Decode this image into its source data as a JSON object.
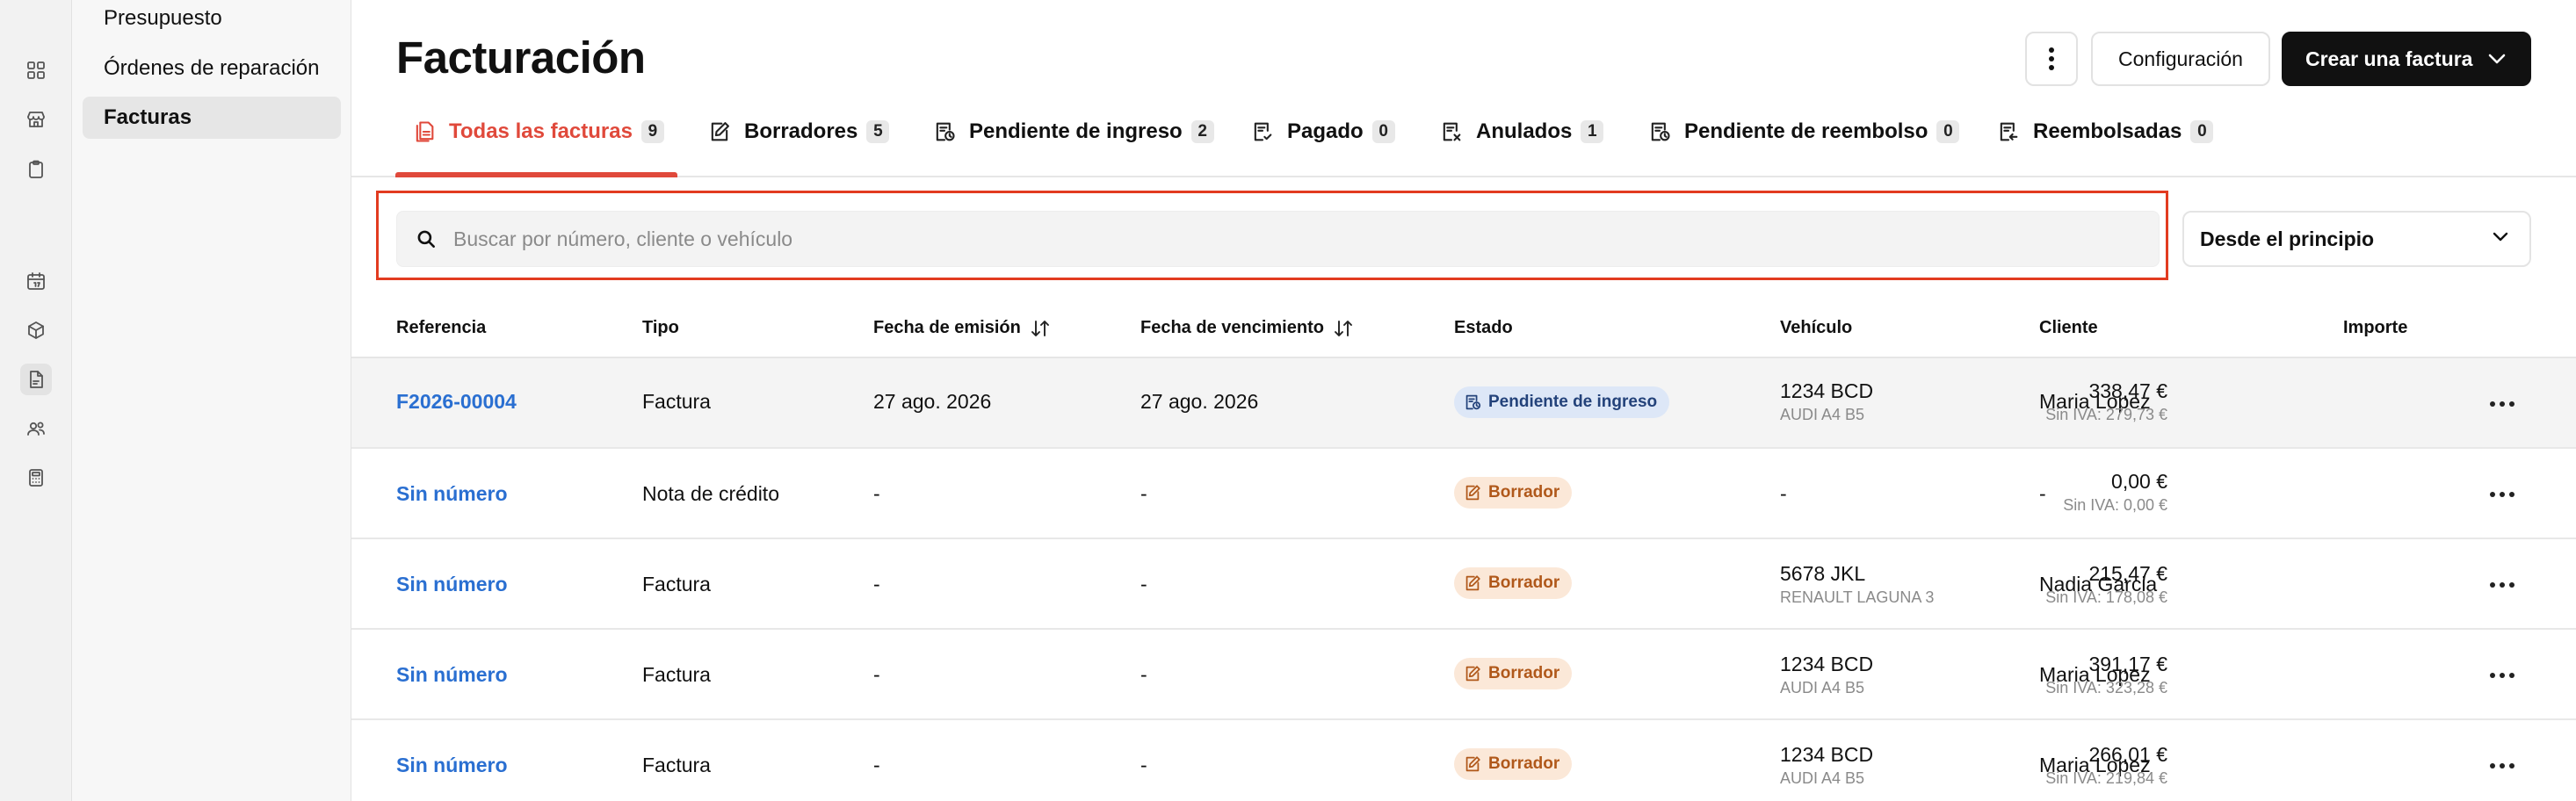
{
  "sidebar": {
    "items": [
      {
        "label": "Presupuesto"
      },
      {
        "label": "Órdenes de reparación"
      },
      {
        "label": "Facturas"
      }
    ]
  },
  "page": {
    "title": "Facturación",
    "config_label": "Configuración",
    "create_label": "Crear una factura"
  },
  "tabs": [
    {
      "label": "Todas las facturas",
      "count": "9"
    },
    {
      "label": "Borradores",
      "count": "5"
    },
    {
      "label": "Pendiente de ingreso",
      "count": "2"
    },
    {
      "label": "Pagado",
      "count": "0"
    },
    {
      "label": "Anulados",
      "count": "1"
    },
    {
      "label": "Pendiente de reembolso",
      "count": "0"
    },
    {
      "label": "Reembolsadas",
      "count": "0"
    }
  ],
  "search": {
    "placeholder": "Buscar por número, cliente o vehículo",
    "value": ""
  },
  "date_filter": {
    "selected": "Desde el principio"
  },
  "table": {
    "headers": {
      "ref": "Referencia",
      "type": "Tipo",
      "issue": "Fecha de emisión",
      "due": "Fecha de vencimiento",
      "status": "Estado",
      "vehicle": "Vehículo",
      "client": "Cliente",
      "amount": "Importe"
    },
    "rows": [
      {
        "ref": "F2026-00004",
        "type": "Factura",
        "issue": "27 ago. 2026",
        "due": "27 ago. 2026",
        "status": "Pendiente de ingreso",
        "plate": "1234 BCD",
        "model": "AUDI A4 B5",
        "client": "Maria Lopez",
        "amount": "338,47 €",
        "net": "Sin IVA: 279,73 €"
      },
      {
        "ref": "Sin número",
        "type": "Nota de crédito",
        "issue": "-",
        "due": "-",
        "status": "Borrador",
        "plate": "-",
        "model": "",
        "client": "-",
        "amount": "0,00 €",
        "net": "Sin IVA: 0,00 €"
      },
      {
        "ref": "Sin número",
        "type": "Factura",
        "issue": "-",
        "due": "-",
        "status": "Borrador",
        "plate": "5678 JKL",
        "model": "RENAULT LAGUNA 3",
        "client": "Nadia Garcia",
        "amount": "215,47 €",
        "net": "Sin IVA: 178,08 €"
      },
      {
        "ref": "Sin número",
        "type": "Factura",
        "issue": "-",
        "due": "-",
        "status": "Borrador",
        "plate": "1234 BCD",
        "model": "AUDI A4 B5",
        "client": "Maria Lopez",
        "amount": "391,17 €",
        "net": "Sin IVA: 323,28 €"
      },
      {
        "ref": "Sin número",
        "type": "Factura",
        "issue": "-",
        "due": "-",
        "status": "Borrador",
        "plate": "1234 BCD",
        "model": "AUDI A4 B5",
        "client": "Maria Lopez",
        "amount": "266,01 €",
        "net": "Sin IVA: 219,84 €"
      }
    ]
  },
  "colors": {
    "accent": "#e0493b",
    "link": "#2a6fd1",
    "pending_bg": "#dde7f7",
    "draft_bg": "#fbe8d8",
    "focus_frame": "#e23b20"
  },
  "icons": {
    "rail": [
      "dashboard-icon",
      "store-icon",
      "clipboard-icon",
      "calendar-icon",
      "box-icon",
      "document-icon",
      "users-icon",
      "calculator-icon"
    ]
  }
}
